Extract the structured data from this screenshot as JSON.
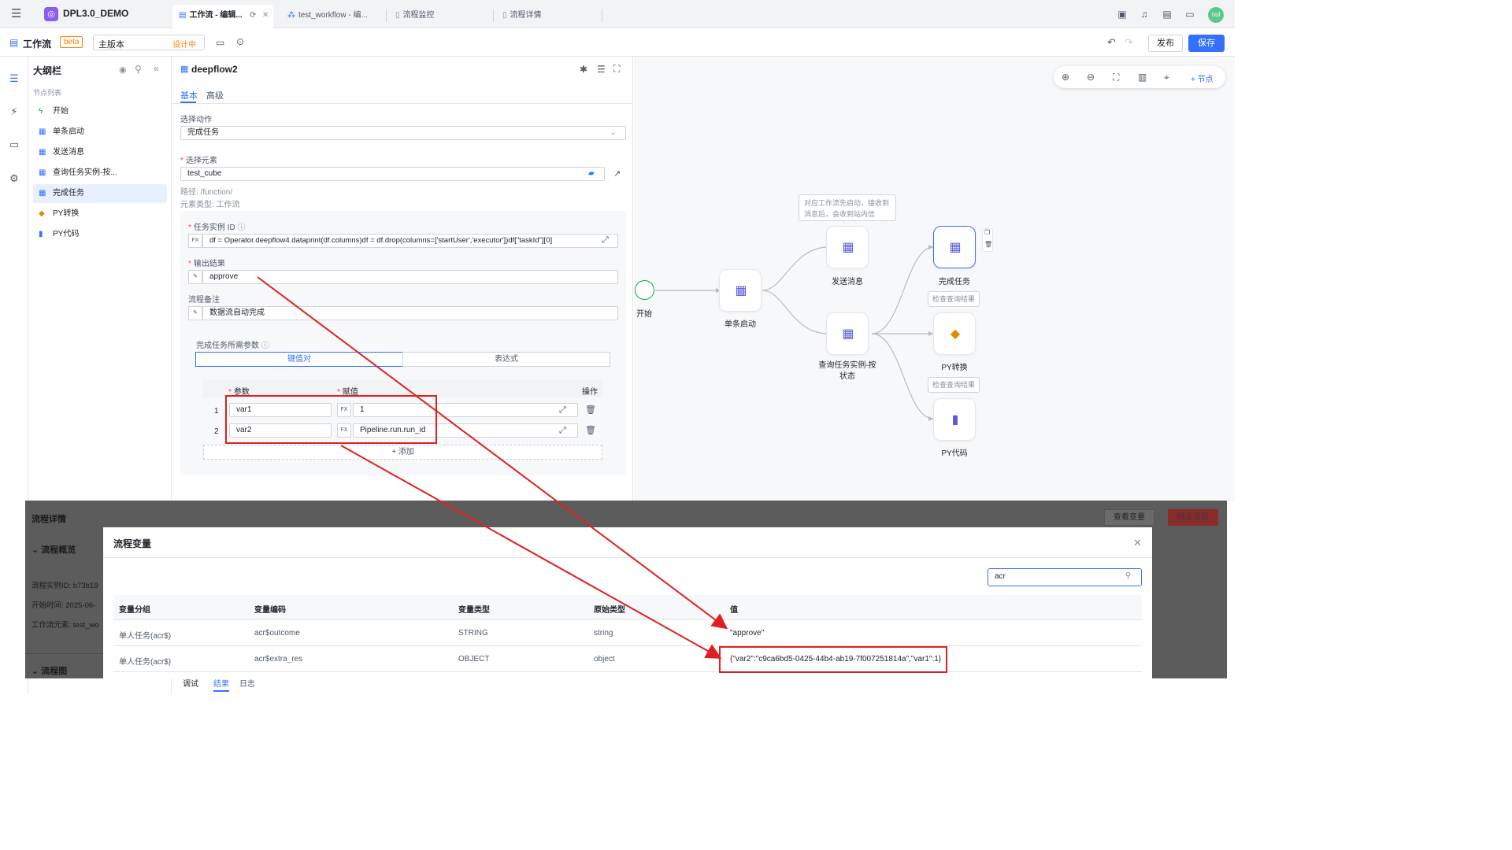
{
  "topbar": {
    "app_title": "DPL3.0_DEMO",
    "tabs": [
      {
        "label": "工作流 - 编辑...",
        "icon": "workflow-icon",
        "active": true
      },
      {
        "label": "test_workflow - 编...",
        "icon": "flow-icon",
        "active": false
      },
      {
        "label": "流程监控",
        "icon": "doc-icon",
        "active": false
      },
      {
        "label": "流程详情",
        "icon": "doc-icon",
        "active": false
      }
    ],
    "avatar": "nul"
  },
  "toolbar": {
    "title": "工作流",
    "beta": "beta",
    "version": "主版本",
    "version_status": "设计中",
    "publish": "发布",
    "save": "保存"
  },
  "outline": {
    "title": "大纲栏",
    "subtitle": "节点列表",
    "nodes": [
      {
        "label": "开始",
        "icon": "lightning-icon"
      },
      {
        "label": "单条启动",
        "icon": "hierarchy-icon"
      },
      {
        "label": "发送消息",
        "icon": "hierarchy-icon"
      },
      {
        "label": "查询任务实例-按...",
        "icon": "hierarchy-icon"
      },
      {
        "label": "完成任务",
        "icon": "hierarchy-icon",
        "selected": true
      },
      {
        "label": "PY转换",
        "icon": "python-icon"
      },
      {
        "label": "PY代码",
        "icon": "code-file-icon"
      }
    ]
  },
  "form": {
    "title": "deepflow2",
    "tab_basic": "基本",
    "tab_advanced": "高级",
    "action_label": "选择动作",
    "action_value": "完成任务",
    "element_label": "选择元素",
    "element_value": "test_cube",
    "path": "路径: /function/",
    "element_type": "元素类型: 工作流",
    "task_id_label": "任务实例 ID",
    "task_id_expr": "df = Operator.deepflow4.dataprint(df.columns)df = df.drop(columns=['startUser','executor'])df[\"taskId\"][0]",
    "output_label": "输出结果",
    "output_value": "approve",
    "remark_label": "流程备注",
    "remark_value": "数据流自动完成",
    "params_label": "完成任务所需参数",
    "seg_kv": "键值对",
    "seg_expr": "表达式",
    "col_param": "参数",
    "col_value": "赋值",
    "col_op": "操作",
    "rows": [
      {
        "idx": "1",
        "param": "var1",
        "value": "1"
      },
      {
        "idx": "2",
        "param": "var2",
        "value": "Pipeline.run.run_id"
      }
    ],
    "add": "添加",
    "fx": "FX"
  },
  "canvas": {
    "add_node": "+ 节点",
    "start": "开始",
    "note": "对应工作流先启动，接收到消息后，会收到站内信",
    "nodes": {
      "single_start": "单条启动",
      "send_msg": "发送消息",
      "query_task": "查询任务实例-按状态",
      "complete_task": "完成任务",
      "py_convert": "PY转换",
      "py_code": "PY代码"
    },
    "check_result": "检查查询结果"
  },
  "background_panel": {
    "title": "流程详情",
    "btn_vars": "查看变量",
    "btn_stop": "终止流程",
    "overview": "流程概览",
    "instance_id": "流程实例ID: b73b19",
    "start_time": "开始时间: 2025-06-",
    "element": "工作流元素: test_wo",
    "diagram": "流程图"
  },
  "bottom_tabs": {
    "debug": "调试",
    "result": "结果",
    "log": "日志"
  },
  "dialog": {
    "title": "流程变量",
    "search_value": "acr",
    "headers": [
      "变量分组",
      "变量编码",
      "变量类型",
      "原始类型",
      "值"
    ],
    "rows": [
      [
        "单人任务(acr$)",
        "acr$outcome",
        "STRING",
        "string",
        "\"approve\""
      ],
      [
        "单人任务(acr$)",
        "acr$extra_res",
        "OBJECT",
        "object",
        "{\"var2\":\"c9ca6bd5-0425-44b4-ab19-7f007251814a\",\"var1\":1}"
      ]
    ]
  },
  "colors": {
    "accent": "#3370ff",
    "annotation": "#e02020"
  }
}
